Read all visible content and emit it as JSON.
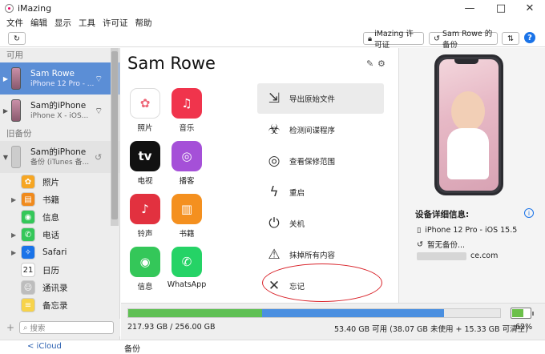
{
  "window": {
    "title": "iMazing",
    "minimize": "—",
    "maximize": "□",
    "close": "✕"
  },
  "menu": [
    "文件",
    "编辑",
    "显示",
    "工具",
    "许可证",
    "帮助"
  ],
  "toolbar": {
    "refresh": "↻",
    "license": "iMazing 许可证",
    "backup": "Sam Rowe 的备份",
    "sort": "⇅",
    "help": "?"
  },
  "sidebar": {
    "section_available": "可用",
    "devices": [
      {
        "name": "Sam Rowe",
        "sub": "iPhone 12 Pro - ..."
      },
      {
        "name": "Sam的iPhone",
        "sub": "iPhone X - iOS..."
      }
    ],
    "section_backups": "旧备份",
    "backup_device": {
      "name": "Sam的iPhone",
      "sub": "备份 (iTunes 备..."
    },
    "apps": [
      {
        "label": "照片",
        "color": "#f6a623",
        "glyph": "✿",
        "caret": ""
      },
      {
        "label": "书籍",
        "color": "#f08a1c",
        "glyph": "▤",
        "caret": "▶"
      },
      {
        "label": "信息",
        "color": "#34c759",
        "glyph": "◉",
        "caret": ""
      },
      {
        "label": "电话",
        "color": "#34c759",
        "glyph": "✆",
        "caret": "▶"
      },
      {
        "label": "Safari",
        "color": "#1a73e8",
        "glyph": "✧",
        "caret": "▶"
      },
      {
        "label": "日历",
        "color": "#ffffff",
        "glyph": "21",
        "caret": ""
      },
      {
        "label": "通讯录",
        "color": "#bdbdbd",
        "glyph": "☺",
        "caret": ""
      },
      {
        "label": "备忘录",
        "color": "#f7d34a",
        "glyph": "≡",
        "caret": ""
      }
    ],
    "search_placeholder": "搜索",
    "add": "+"
  },
  "main": {
    "title": "Sam Rowe",
    "apps": [
      {
        "label": "照片",
        "color": "#ffffff",
        "glyph": "✿"
      },
      {
        "label": "音乐",
        "color": "#f0344c",
        "glyph": "♫"
      },
      {
        "label": "电视",
        "color": "#111111",
        "glyph": "tv"
      },
      {
        "label": "播客",
        "color": "#a550d8",
        "glyph": "◎"
      },
      {
        "label": "铃声",
        "color": "#e2313f",
        "glyph": "♪"
      },
      {
        "label": "书籍",
        "color": "#f4901f",
        "glyph": "▥"
      },
      {
        "label": "信息",
        "color": "#34c759",
        "glyph": "◉"
      },
      {
        "label": "WhatsApp",
        "color": "#25d366",
        "glyph": "✆"
      }
    ],
    "actions": [
      {
        "label": "导出原始文件",
        "glyph": "⇲"
      },
      {
        "label": "检测间谍程序",
        "glyph": "☣"
      },
      {
        "label": "查看保修范围",
        "glyph": "◎"
      },
      {
        "label": "重启",
        "glyph": "ϟ"
      },
      {
        "label": "关机",
        "glyph": "⏻"
      },
      {
        "label": "抹掉所有内容",
        "glyph": "⚠"
      },
      {
        "label": "忘记",
        "glyph": "✕"
      }
    ]
  },
  "device_info": {
    "title": "设备详细信息:",
    "model": "iPhone 12 Pro - iOS 15.5",
    "backup": "暂无备份...",
    "email_suffix": "ce.com"
  },
  "storage": {
    "used_total": "217.93 GB / 256.00 GB",
    "free_detail": "53.40 GB 可用 (38.07 GB 未使用 + 15.33 GB 可清空)",
    "battery": "62%",
    "battery_level": 0.62,
    "segments": [
      {
        "fraction": 0.36,
        "color": "#5fc054"
      },
      {
        "fraction": 0.49,
        "color": "#4a8fe0"
      },
      {
        "fraction": 0.15,
        "color": "#e8e8e8"
      }
    ]
  },
  "bottom_strip": {
    "left": "< iCloud",
    "right": "备份"
  }
}
